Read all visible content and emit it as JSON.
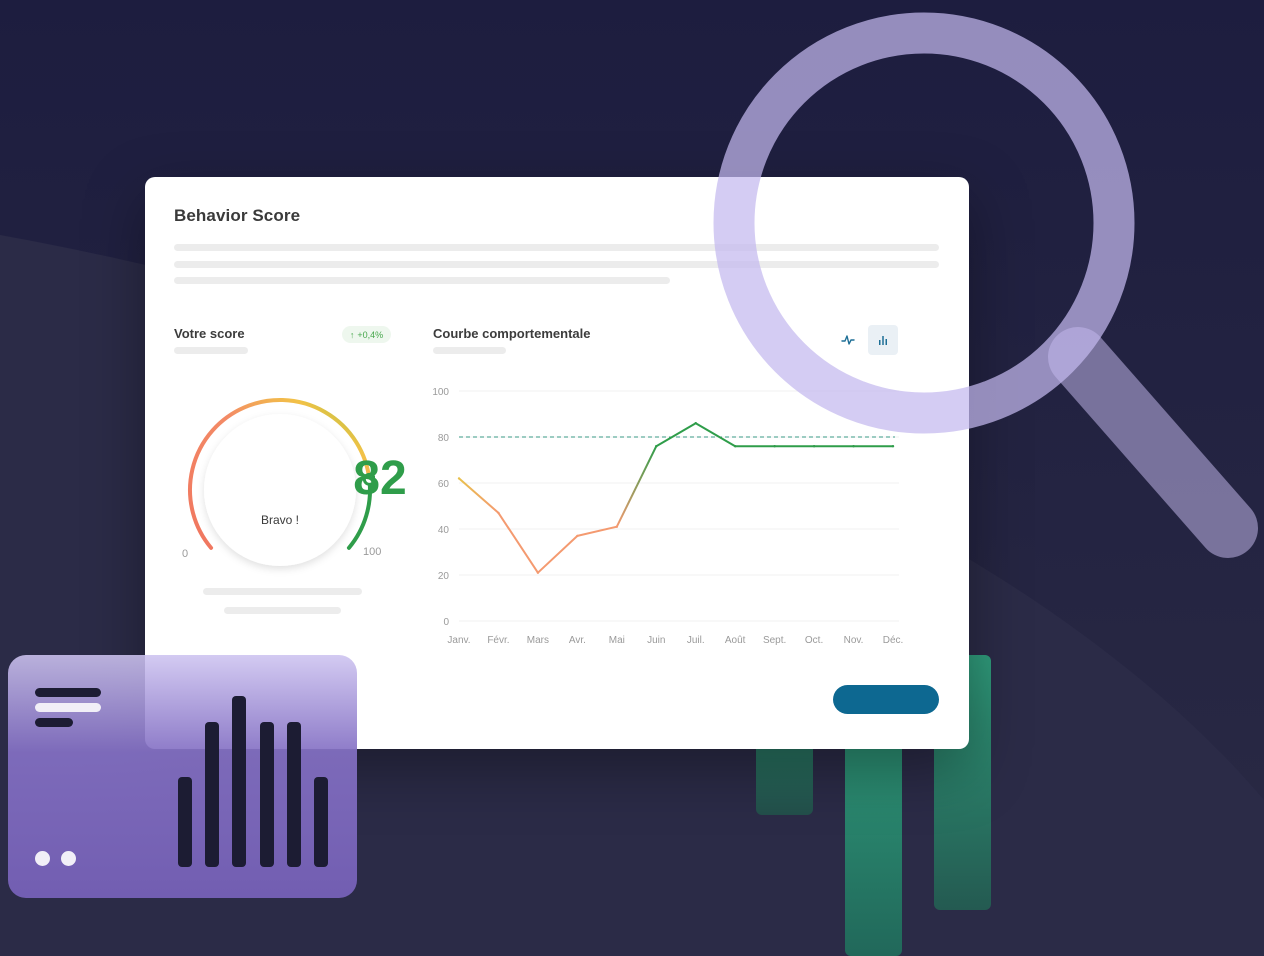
{
  "card": {
    "title": "Behavior Score"
  },
  "score_panel": {
    "title": "Votre score",
    "trend": "+0,4%",
    "trend_icon": "arrow-up-icon",
    "score": "82",
    "message": "Bravo !",
    "gauge_min": "0",
    "gauge_max": "100",
    "gauge_value": 82
  },
  "behavior_chart": {
    "title": "Courbe comportementale",
    "view_icons": [
      "line-chart-icon",
      "bar-chart-icon"
    ]
  },
  "chart_data": {
    "type": "line",
    "title": "Courbe comportementale",
    "categories": [
      "Janv.",
      "Févr.",
      "Mars",
      "Avr.",
      "Mai",
      "Juin",
      "Juil.",
      "Août",
      "Sept.",
      "Oct.",
      "Nov.",
      "Déc."
    ],
    "series": [
      {
        "values": [
          62,
          47,
          21,
          37,
          41,
          76,
          86,
          76,
          76,
          76,
          76,
          76
        ]
      }
    ],
    "reference_line": 80,
    "yticks": [
      "0",
      "20",
      "40",
      "60",
      "80",
      "100"
    ],
    "ylim": [
      0,
      100
    ],
    "grid": true
  },
  "colors": {
    "background": "#202043",
    "card": "#ffffff",
    "score_green": "#2f9d4a",
    "cta": "#0d6891",
    "magnifier": "#bfb4e8",
    "accent_green": "#2a8a6f",
    "panel_purple": "#7560b6"
  },
  "decor": {
    "magnifier_icon": "magnifier-icon",
    "panel_icon": "bar-chart-icon"
  }
}
